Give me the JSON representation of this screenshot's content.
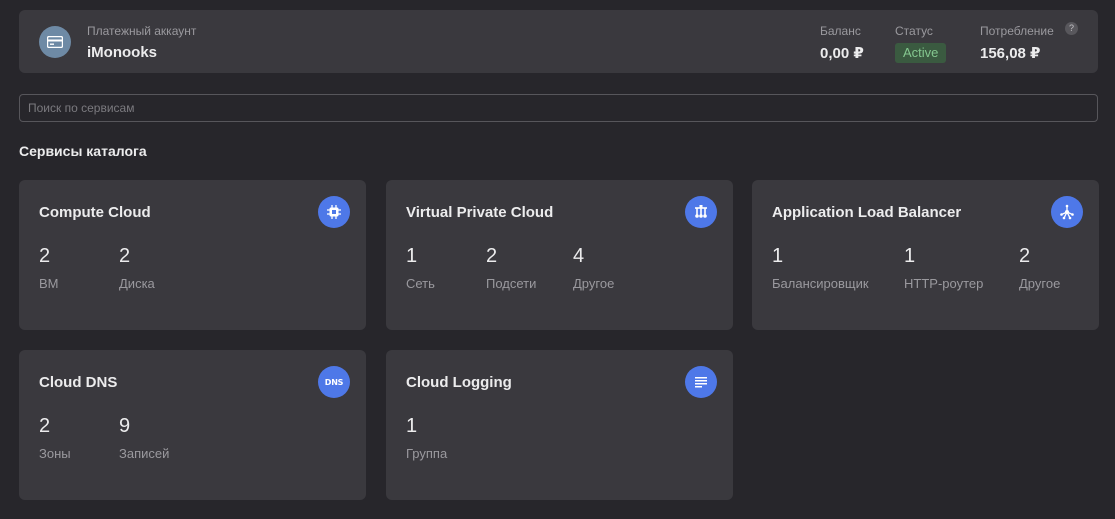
{
  "account": {
    "label": "Платежный аккаунт",
    "name": "iMonooks",
    "icon": "credit-card-icon",
    "balance_label": "Баланс",
    "balance_value": "0,00 ₽",
    "status_label": "Статус",
    "status_value": "Active",
    "consumption_label": "Потребление",
    "consumption_value": "156,08 ₽",
    "help_glyph": "?"
  },
  "search": {
    "placeholder": "Поиск по сервисам",
    "value": ""
  },
  "section_title": "Сервисы каталога",
  "colors": {
    "accent": "#4e78e8",
    "status_bg": "#3a5a40",
    "status_text": "#84c78f"
  },
  "cards": [
    {
      "title": "Compute Cloud",
      "icon": "cpu-chip-icon",
      "metrics": [
        {
          "value": "2",
          "label": "ВМ"
        },
        {
          "value": "2",
          "label": "Диска"
        }
      ]
    },
    {
      "title": "Virtual Private Cloud",
      "icon": "network-icon",
      "metrics": [
        {
          "value": "1",
          "label": "Сеть"
        },
        {
          "value": "2",
          "label": "Подсети"
        },
        {
          "value": "4",
          "label": "Другое"
        }
      ]
    },
    {
      "title": "Application Load Balancer",
      "icon": "load-balancer-icon",
      "metrics": [
        {
          "value": "1",
          "label": "Балансировщик"
        },
        {
          "value": "1",
          "label": "HTTP-роутер"
        },
        {
          "value": "2",
          "label": "Другое"
        }
      ]
    },
    {
      "title": "Cloud DNS",
      "icon": "dns-icon",
      "icon_text": "DNS",
      "metrics": [
        {
          "value": "2",
          "label": "Зоны"
        },
        {
          "value": "9",
          "label": "Записей"
        }
      ]
    },
    {
      "title": "Cloud Logging",
      "icon": "log-lines-icon",
      "metrics": [
        {
          "value": "1",
          "label": "Группа"
        }
      ]
    }
  ]
}
